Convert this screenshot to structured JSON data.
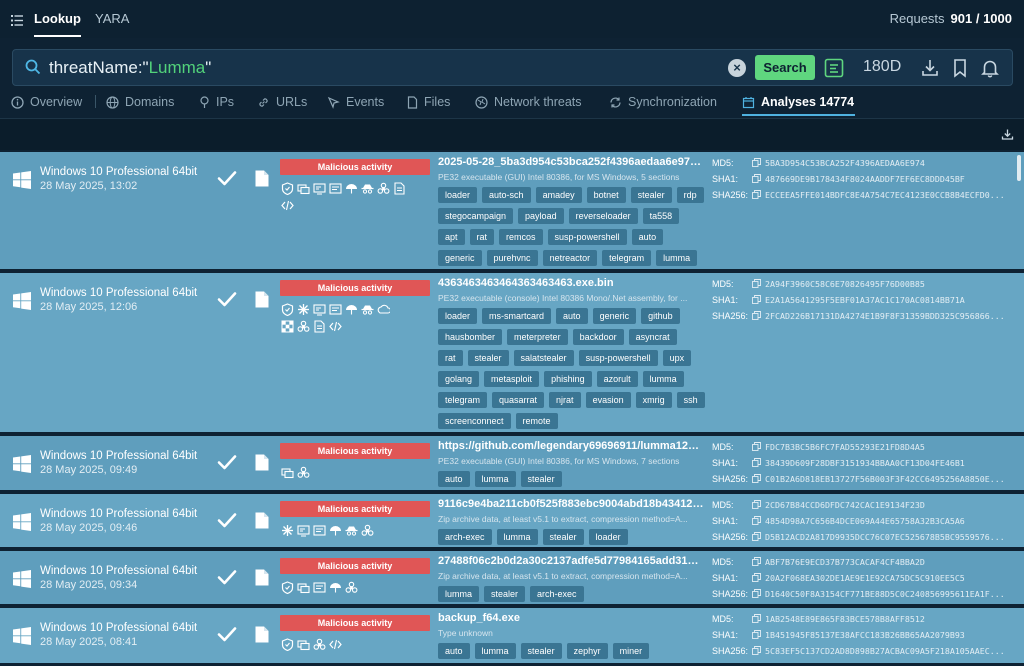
{
  "topbar": {
    "tabs": [
      "Lookup",
      "YARA"
    ],
    "requests_label": "Requests",
    "requests_value": "901 / 1000"
  },
  "search": {
    "query_key": "threatName:\"",
    "query_value": "Lumma",
    "query_end": "\"",
    "button_label": "Search",
    "period": "180D"
  },
  "nav": {
    "tabs": [
      {
        "label": "Overview",
        "icon": "info-icon"
      },
      {
        "label": "Domains",
        "icon": "globe-icon"
      },
      {
        "label": "IPs",
        "icon": "pin-icon"
      },
      {
        "label": "URLs",
        "icon": "link-icon"
      },
      {
        "label": "Events",
        "icon": "cursor-icon"
      },
      {
        "label": "Files",
        "icon": "file-icon"
      },
      {
        "label": "Network threats",
        "icon": "network-icon"
      },
      {
        "label": "Synchronization",
        "icon": "sync-icon"
      },
      {
        "label": "Analyses 14774",
        "icon": "calendar-icon"
      }
    ]
  },
  "rows": [
    {
      "os": "Windows 10 Professional 64bit",
      "date": "28 May 2025, 13:02",
      "verdict": "Malicious activity",
      "title": "2025-05-28_5ba3d954c53bca252f4396aedaa6e974_...",
      "subtitle": "PE32 executable (GUI) Intel 80386, for MS Windows, 5 sections",
      "tags": [
        "loader",
        "auto-sch",
        "amadey",
        "botnet",
        "stealer",
        "rdp",
        "stegocampaign",
        "payload",
        "reverseloader",
        "ta558",
        "apt",
        "rat",
        "remcos",
        "susp-powershell",
        "auto",
        "generic",
        "purehvnc",
        "netreactor",
        "telegram",
        "lumma"
      ],
      "md5": "5BA3D954C53BCA252F4396AEDAA6E974",
      "sha1": "487669DE9B178434F8024AADDF7EF6EC8DDD45BF",
      "sha256": "ECCEEA5FFE014BDFC8E4A754C7EC4123E0CCB8B4ECFD0..."
    },
    {
      "os": "Windows 10 Professional 64bit",
      "date": "28 May 2025, 12:06",
      "verdict": "Malicious activity",
      "title": "4363463463464363463463.exe.bin",
      "subtitle": "PE32 executable (console) Intel 80386 Mono/.Net assembly, for ...",
      "tags": [
        "loader",
        "ms-smartcard",
        "auto",
        "generic",
        "github",
        "hausbomber",
        "meterpreter",
        "backdoor",
        "asyncrat",
        "rat",
        "stealer",
        "salatstealer",
        "susp-powershell",
        "upx",
        "golang",
        "metasploit",
        "phishing",
        "azorult",
        "lumma",
        "telegram",
        "quasarrat",
        "njrat",
        "evasion",
        "xmrig",
        "ssh",
        "screenconnect",
        "remote"
      ],
      "md5": "2A94F3960C58C6E70826495F76D00B85",
      "sha1": "E2A1A5641295F5EBF01A37AC1C170AC0814BB71A",
      "sha256": "2FCAD226B17131DA4274E1B9F8F31359BDD325C956866..."
    },
    {
      "os": "Windows 10 Professional 64bit",
      "date": "28 May 2025, 09:49",
      "verdict": "Malicious activity",
      "title": "https://github.com/legendary69696911/lumma1212/r...",
      "subtitle": "PE32 executable (GUI) Intel 80386, for MS Windows, 7 sections",
      "tags": [
        "auto",
        "lumma",
        "stealer"
      ],
      "md5": "FDC7B3BC5B6FC7FAD55293E21FD8D4A5",
      "sha1": "38439D609F28DBF3151934BBAA0CF13D04FE46B1",
      "sha256": "C01B2A6D818EB13727F56B003F3F42CC6495256A8850E..."
    },
    {
      "os": "Windows 10 Professional 64bit",
      "date": "28 May 2025, 09:46",
      "verdict": "Malicious activity",
      "title": "9116c9e4ba211cb0f525f883ebc9004abd18b43412e...",
      "subtitle": "Zip archive data, at least v5.1 to extract, compression method=A...",
      "tags": [
        "arch-exec",
        "lumma",
        "stealer",
        "loader"
      ],
      "md5": "2CD67B84CCD6DFDC742CAC1E9134F23D",
      "sha1": "4854D98A7C656B4DCE069A44E65758A32B3CA5A6",
      "sha256": "D5B12ACD2A817D9935DCC76C07EC525678B5BC9559576..."
    },
    {
      "os": "Windows 10 Professional 64bit",
      "date": "28 May 2025, 09:34",
      "verdict": "Malicious activity",
      "title": "27488f06c2b0d2a30c2137adfe5d77984165add310b...",
      "subtitle": "Zip archive data, at least v5.1 to extract, compression method=A...",
      "tags": [
        "lumma",
        "stealer",
        "arch-exec"
      ],
      "md5": "ABF7B76E9ECD37B773CACAF4CF4BBA2D",
      "sha1": "20A2F068EA302DE1AE9E1E92CA75DC5C910EE5C5",
      "sha256": "D1640C50F8A3154CF771BE88D5C0C240856995611EA1F..."
    },
    {
      "os": "Windows 10 Professional 64bit",
      "date": "28 May 2025, 08:41",
      "verdict": "Malicious activity",
      "title": "backup_f64.exe",
      "subtitle": "Type unknown",
      "tags": [
        "auto",
        "lumma",
        "stealer",
        "zephyr",
        "miner"
      ],
      "md5": "1AB2548E89E865F83BCE578B8AFF8512",
      "sha1": "1B451945F85137E38AFCC183B26BB65AA2079B93",
      "sha256": "5C83EF5C137CD2AD8D898B27ACBAC09A5F218A105AAEC..."
    }
  ],
  "hash_labels": {
    "md5": "MD5:",
    "sha1": "SHA1:",
    "sha256": "SHA256:"
  }
}
